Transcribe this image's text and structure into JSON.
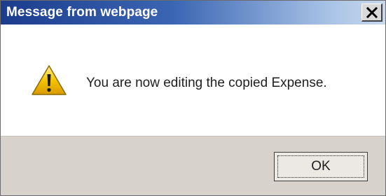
{
  "window": {
    "title": "Message from webpage",
    "close_icon": "close-icon"
  },
  "dialog": {
    "icon": "warning-icon",
    "message": "You are now editing the copied Expense.",
    "ok_label": "OK"
  },
  "colors": {
    "titlebar_start": "#1c3c8e",
    "titlebar_end": "#c8d8ee",
    "footer": "#d8d2cc",
    "warning_yellow": "#f5c400"
  }
}
